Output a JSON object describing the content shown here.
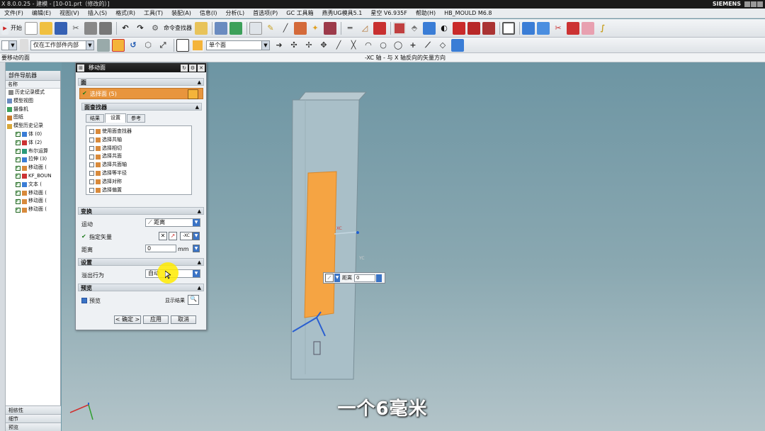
{
  "app": {
    "title": "X 8.0.0.25 - 建模 - [10-01.prt（修改的）]",
    "brand": "SIEMENS"
  },
  "menu": [
    "文件(F)",
    "编辑(E)",
    "视图(V)",
    "插入(S)",
    "格式(R)",
    "工具(T)",
    "装配(A)",
    "信息(I)",
    "分析(L)",
    "首选项(P)",
    "GC 工具箱",
    "燕秀UG模具5.1",
    "星空 V6.935F",
    "帮助(H)",
    "HB_MOULD M6.8"
  ],
  "toolbar1": {
    "start_label": "开始",
    "command_finder_label": "命令查找器"
  },
  "toolbar2": {
    "filter_value": "",
    "scope_value": "仅在工作部件内部",
    "face_rule_value": "单个面"
  },
  "cue": {
    "left_text": "要移动的面",
    "mid_text": "-XC 轴 - 与 X 轴反向的矢量方向"
  },
  "navigator": {
    "title": "部件导航器",
    "column_name": "名称",
    "items": [
      "历史记录模式",
      "模型视图",
      "摄像机",
      "图纸",
      "模型历史记录",
      "体 (0)",
      "体 (2)",
      "布尔运算",
      "拉伸 (3)",
      "移动面 (",
      "KF_BOUN",
      "文本 (",
      "移动面 (",
      "移动面 (",
      "移动面 ("
    ],
    "sections": [
      "相依性",
      "细节",
      "预览"
    ]
  },
  "dialog": {
    "title": "移动面",
    "face_group": "面",
    "select_face": "选择面 (5)",
    "face_finder": "面查找器",
    "tabs": [
      "结果",
      "设置",
      "参考"
    ],
    "filter_items": [
      "使用面查找器",
      "选择共轴",
      "选择相切",
      "选择共面",
      "选择共面轴",
      "选择等半径",
      "选择对称",
      "选择偏置"
    ],
    "transform_group": "变换",
    "motion_label": "运动",
    "motion_value": "距离",
    "vector_label": "指定矢量",
    "distance_label": "距离",
    "distance_value": "0",
    "distance_unit": "mm",
    "settings_group": "设置",
    "overflow_label": "溢出行为",
    "overflow_value": "自动",
    "preview_group": "预览",
    "preview_label": "预览",
    "show_result": "显示结果",
    "ok": "< 确定 >",
    "apply": "应用",
    "cancel": "取消"
  },
  "float_input": {
    "label": "距离",
    "value": "0"
  },
  "axes": {
    "xc": "XC",
    "yc": "YC"
  },
  "subtitle": "一个6毫米",
  "colors": {
    "highlight_face": "#f5a443",
    "model": "#a9bfc8",
    "background_top": "#6d95a3",
    "background_bottom": "#b3c4c9",
    "dialog_title": "#1c1c1c",
    "selected_row": "#e8953d"
  }
}
